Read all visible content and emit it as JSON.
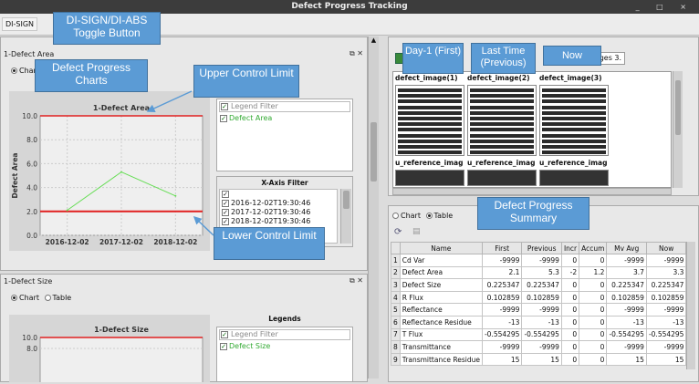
{
  "window": {
    "title": "Defect Progress Tracking",
    "controls": "_ □ ×"
  },
  "menu": {
    "toggle_label": "DI-SIGN"
  },
  "callouts": {
    "toggle": "DI-SIGN/DI-ABS Toggle Button",
    "charts": "Defect Progress Charts",
    "ucl": "Upper Control Limit",
    "lcl": "Lower Control Limit",
    "day1": "Day-1 (First)",
    "last": "Last Time (Previous)",
    "now": "Now",
    "summary": "Defect Progress Summary"
  },
  "panel1": {
    "title": "1-Defect Area",
    "mode": "Chart",
    "legend_filter_placeholder": "Legend Filter",
    "legend_items": [
      "Defect Area"
    ],
    "xfilter_title": "X-Axis Filter",
    "xfilter_items": [
      "2016-12-02T19:30:46",
      "2017-12-02T19:30:46",
      "2018-12-02T19:30:46"
    ]
  },
  "panel2": {
    "title": "1-Defect Size",
    "mode_chart": "Chart",
    "mode_table": "Table",
    "legends_title": "Legends",
    "legend_filter_placeholder": "Legend Filter",
    "legend_items": [
      "Defect Size"
    ]
  },
  "chart_data": [
    {
      "type": "line",
      "title": "1-Defect Area",
      "ylabel": "Defect Area",
      "xlabel": "",
      "categories": [
        "2016-12-02",
        "2017-12-02",
        "2018-12-02"
      ],
      "series": [
        {
          "name": "Defect Area",
          "values": [
            2.1,
            5.3,
            3.3
          ],
          "color": "#66dd55"
        }
      ],
      "control_limits": {
        "upper": 10.0,
        "lower": 2.0,
        "color": "#e02020"
      },
      "ylim": [
        0,
        10.0
      ],
      "yticks": [
        "0.0",
        "2.0",
        "4.0",
        "6.0",
        "8.0",
        "10.0"
      ],
      "grid": true
    },
    {
      "type": "line",
      "title": "1-Defect Size",
      "ylabel": "",
      "xlabel": "",
      "categories": [],
      "series": [
        {
          "name": "Defect Size",
          "values": []
        }
      ],
      "control_limits": {
        "upper": 10.0
      },
      "ylim": [
        0,
        10.0
      ],
      "yticks": [
        "8.0",
        "10.0"
      ],
      "grid": true
    }
  ],
  "image_panel": {
    "tab_text": "mages 3.",
    "columns": [
      "defect_image(1)",
      "defect_image(2)",
      "defect_image(3)"
    ],
    "ref_row": [
      "u_reference_imag",
      "u_reference_imag",
      "u_reference_imag"
    ]
  },
  "summary": {
    "mode_chart": "Chart",
    "mode_table": "Table",
    "columns": [
      "Name",
      "First",
      "Previous",
      "Incr",
      "Accum",
      "Mv Avg",
      "Now"
    ],
    "rows": [
      [
        "1",
        "Cd Var",
        "-9999",
        "-9999",
        "0",
        "0",
        "-9999",
        "-9999"
      ],
      [
        "2",
        "Defect Area",
        "2.1",
        "5.3",
        "-2",
        "1.2",
        "3.7",
        "3.3"
      ],
      [
        "3",
        "Defect Size",
        "0.225347",
        "0.225347",
        "0",
        "0",
        "0.225347",
        "0.225347"
      ],
      [
        "4",
        "R Flux",
        "0.102859",
        "0.102859",
        "0",
        "0",
        "0.102859",
        "0.102859"
      ],
      [
        "5",
        "Reflectance",
        "-9999",
        "-9999",
        "0",
        "0",
        "-9999",
        "-9999"
      ],
      [
        "6",
        "Reflectance Residue",
        "-13",
        "-13",
        "0",
        "0",
        "-13",
        "-13"
      ],
      [
        "7",
        "T Flux",
        "-0.554295",
        "-0.554295",
        "0",
        "0",
        "-0.554295",
        "-0.554295"
      ],
      [
        "8",
        "Transmittance",
        "-9999",
        "-9999",
        "0",
        "0",
        "-9999",
        "-9999"
      ],
      [
        "9",
        "Transmittance Residue",
        "15",
        "15",
        "0",
        "0",
        "15",
        "15"
      ]
    ]
  }
}
